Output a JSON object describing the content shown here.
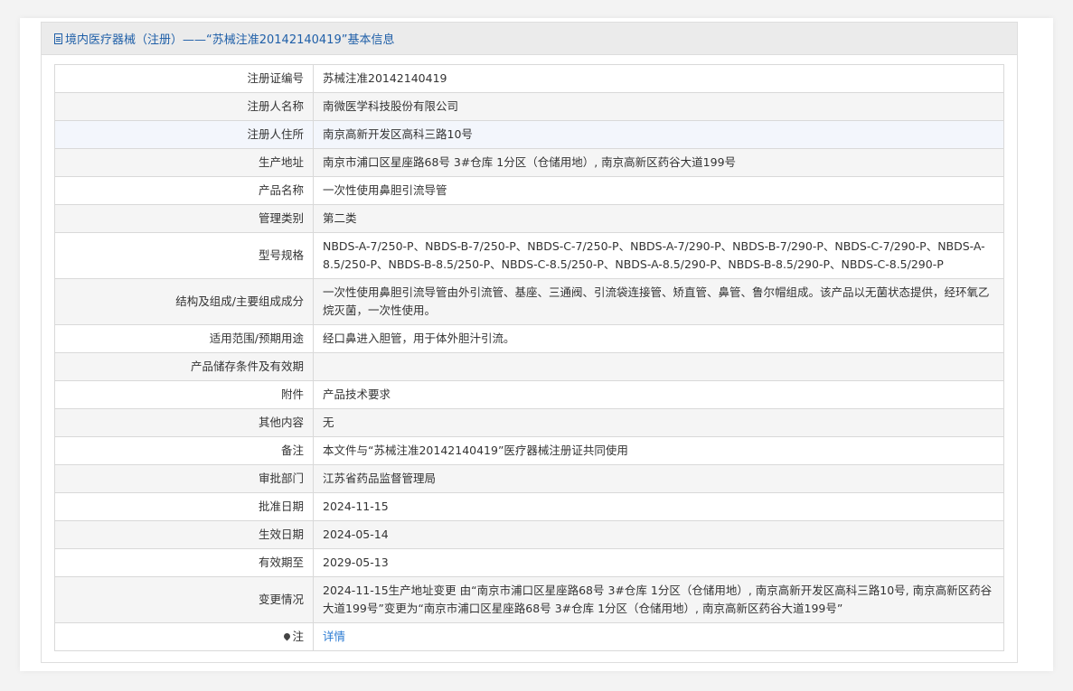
{
  "header": {
    "title": "境内医疗器械（注册）——“苏械注准20142140419”基本信息"
  },
  "rows": [
    {
      "label": "注册证编号",
      "value": "苏械注准20142140419"
    },
    {
      "label": "注册人名称",
      "value": "南微医学科技股份有限公司"
    },
    {
      "label": "注册人住所",
      "value": "南京高新开发区高科三路10号"
    },
    {
      "label": "生产地址",
      "value": "南京市浦口区星座路68号 3#仓库 1分区（仓储用地）, 南京高新区药谷大道199号"
    },
    {
      "label": "产品名称",
      "value": "一次性使用鼻胆引流导管"
    },
    {
      "label": "管理类别",
      "value": "第二类"
    },
    {
      "label": "型号规格",
      "value": "NBDS-A-7/250-P、NBDS-B-7/250-P、NBDS-C-7/250-P、NBDS-A-7/290-P、NBDS-B-7/290-P、NBDS-C-7/290-P、NBDS-A-8.5/250-P、NBDS-B-8.5/250-P、NBDS-C-8.5/250-P、NBDS-A-8.5/290-P、NBDS-B-8.5/290-P、NBDS-C-8.5/290-P"
    },
    {
      "label": "结构及组成/主要组成成分",
      "value": "一次性使用鼻胆引流导管由外引流管、基座、三通阀、引流袋连接管、矫直管、鼻管、鲁尔帽组成。该产品以无菌状态提供，经环氧乙烷灭菌，一次性使用。"
    },
    {
      "label": "适用范围/预期用途",
      "value": "经口鼻进入胆管，用于体外胆汁引流。"
    },
    {
      "label": "产品储存条件及有效期",
      "value": ""
    },
    {
      "label": "附件",
      "value": "产品技术要求"
    },
    {
      "label": "其他内容",
      "value": "无"
    },
    {
      "label": "备注",
      "value": "本文件与“苏械注准20142140419”医疗器械注册证共同使用"
    },
    {
      "label": "审批部门",
      "value": "江苏省药品监督管理局"
    },
    {
      "label": "批准日期",
      "value": "2024-11-15"
    },
    {
      "label": "生效日期",
      "value": "2024-05-14"
    },
    {
      "label": "有效期至",
      "value": "2029-05-13"
    },
    {
      "label": "变更情况",
      "value": "2024-11-15生产地址变更 由“南京市浦口区星座路68号 3#仓库 1分区（仓储用地）, 南京高新开发区高科三路10号, 南京高新区药谷大道199号”变更为“南京市浦口区星座路68号 3#仓库 1分区（仓储用地）, 南京高新区药谷大道199号”"
    },
    {
      "label": "注",
      "value": "详情"
    }
  ],
  "icons": {
    "header": "document-icon",
    "note": "pin-icon"
  },
  "colors": {
    "title": "#1f5fa8",
    "link": "#2a7ad2"
  }
}
